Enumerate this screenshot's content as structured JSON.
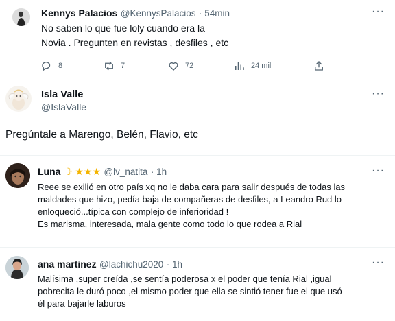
{
  "tweet1": {
    "name": "Kennys Palacios",
    "handle": "@KennysPalacios",
    "time": "· 54min",
    "text_line1": "No saben lo que fue loly cuando era la",
    "text_line2": "Novia . Pregunten en revistas , desfiles , etc",
    "replies": "8",
    "retweets": "7",
    "likes": "72",
    "views": "24 mil"
  },
  "profile": {
    "name": "Isla Valle",
    "handle": "@IslaValle",
    "text": "Pregúntale a Marengo, Belén,  Flavio, etc"
  },
  "reply1": {
    "name": "Luna",
    "stars": "☽ ★★★",
    "handle": "@lv_natita",
    "time": "· 1h",
    "line1": "Reee se exilió en otro país xq no le daba cara para salir después de todas las",
    "line2": "maldades que hizo, pedía baja de compañeras de desfiles, a Leandro Rud lo",
    "line3": "enloqueció...típica con complejo de inferioridad !",
    "line4": "Es marisma, interesada, mala gente como todo lo que rodea a Rial"
  },
  "reply2": {
    "name": "ana martinez",
    "handle": "@lachichu2020",
    "time": "· 1h",
    "line1": "Malísima ,super creída ,se sentía poderosa x el poder que tenía Rial ,igual",
    "line2": "pobrecita le duró poco ,el mismo poder que ella se sintió tener fue el que usó",
    "line3": "él para bajarle laburos"
  },
  "more_glyph": "···",
  "colors": {
    "text": "#0f1419",
    "secondary": "#536471",
    "divider": "#eff3f4",
    "star": "#f4b400"
  }
}
